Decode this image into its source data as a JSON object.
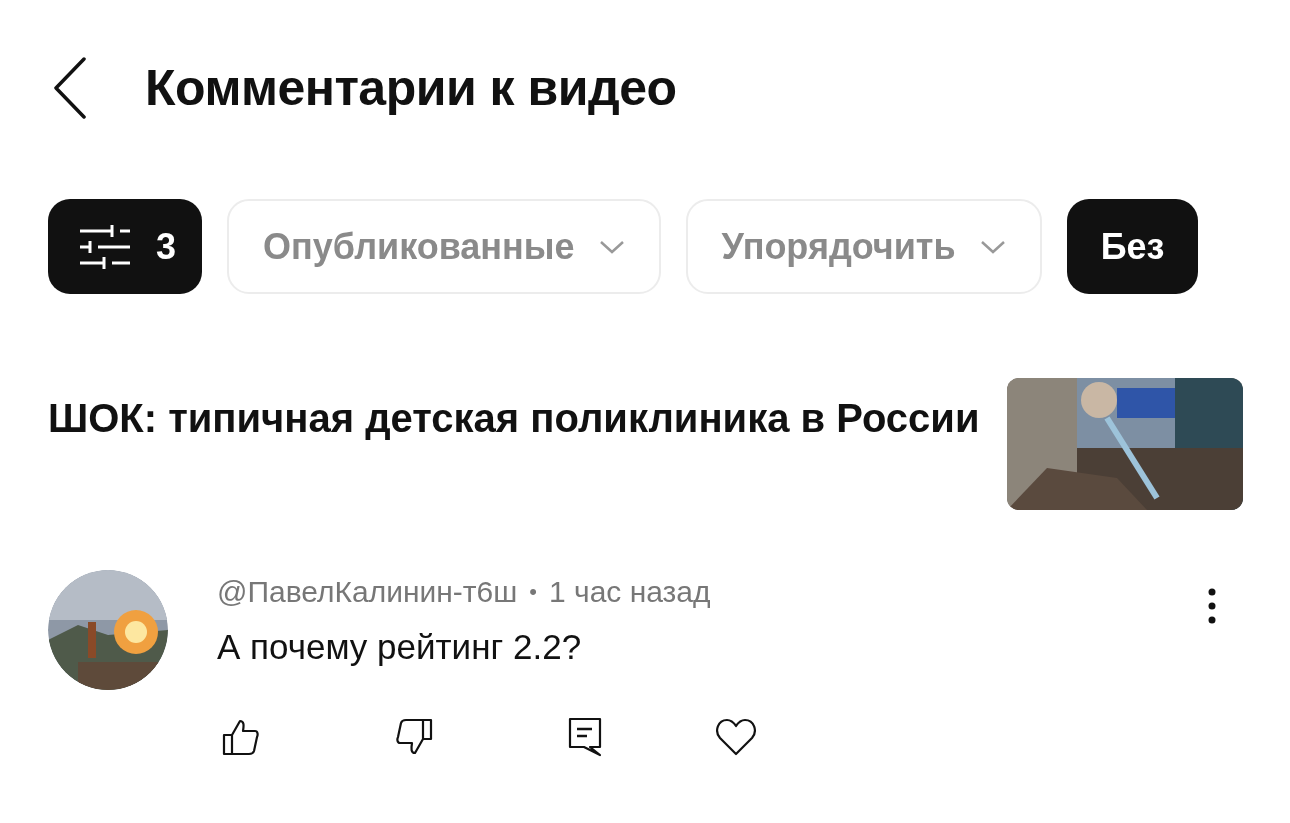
{
  "header": {
    "title": "Комментарии к видео"
  },
  "chips": [
    {
      "kind": "filter",
      "label": "3",
      "selected": true
    },
    {
      "kind": "dropdown",
      "label": "Опубликованные",
      "selected": false
    },
    {
      "kind": "dropdown",
      "label": "Упорядочить",
      "selected": false
    },
    {
      "kind": "plain",
      "label": "Без",
      "selected": true
    }
  ],
  "video": {
    "title": "ШОК: типичная детская поликлиника в России"
  },
  "comments": [
    {
      "author": "@ПавелКалинин-т6ш",
      "separator": "•",
      "time": "1 час назад",
      "text": "А почему рейтинг 2.2?",
      "liked": false,
      "disliked": false,
      "hearted": false
    }
  ]
}
